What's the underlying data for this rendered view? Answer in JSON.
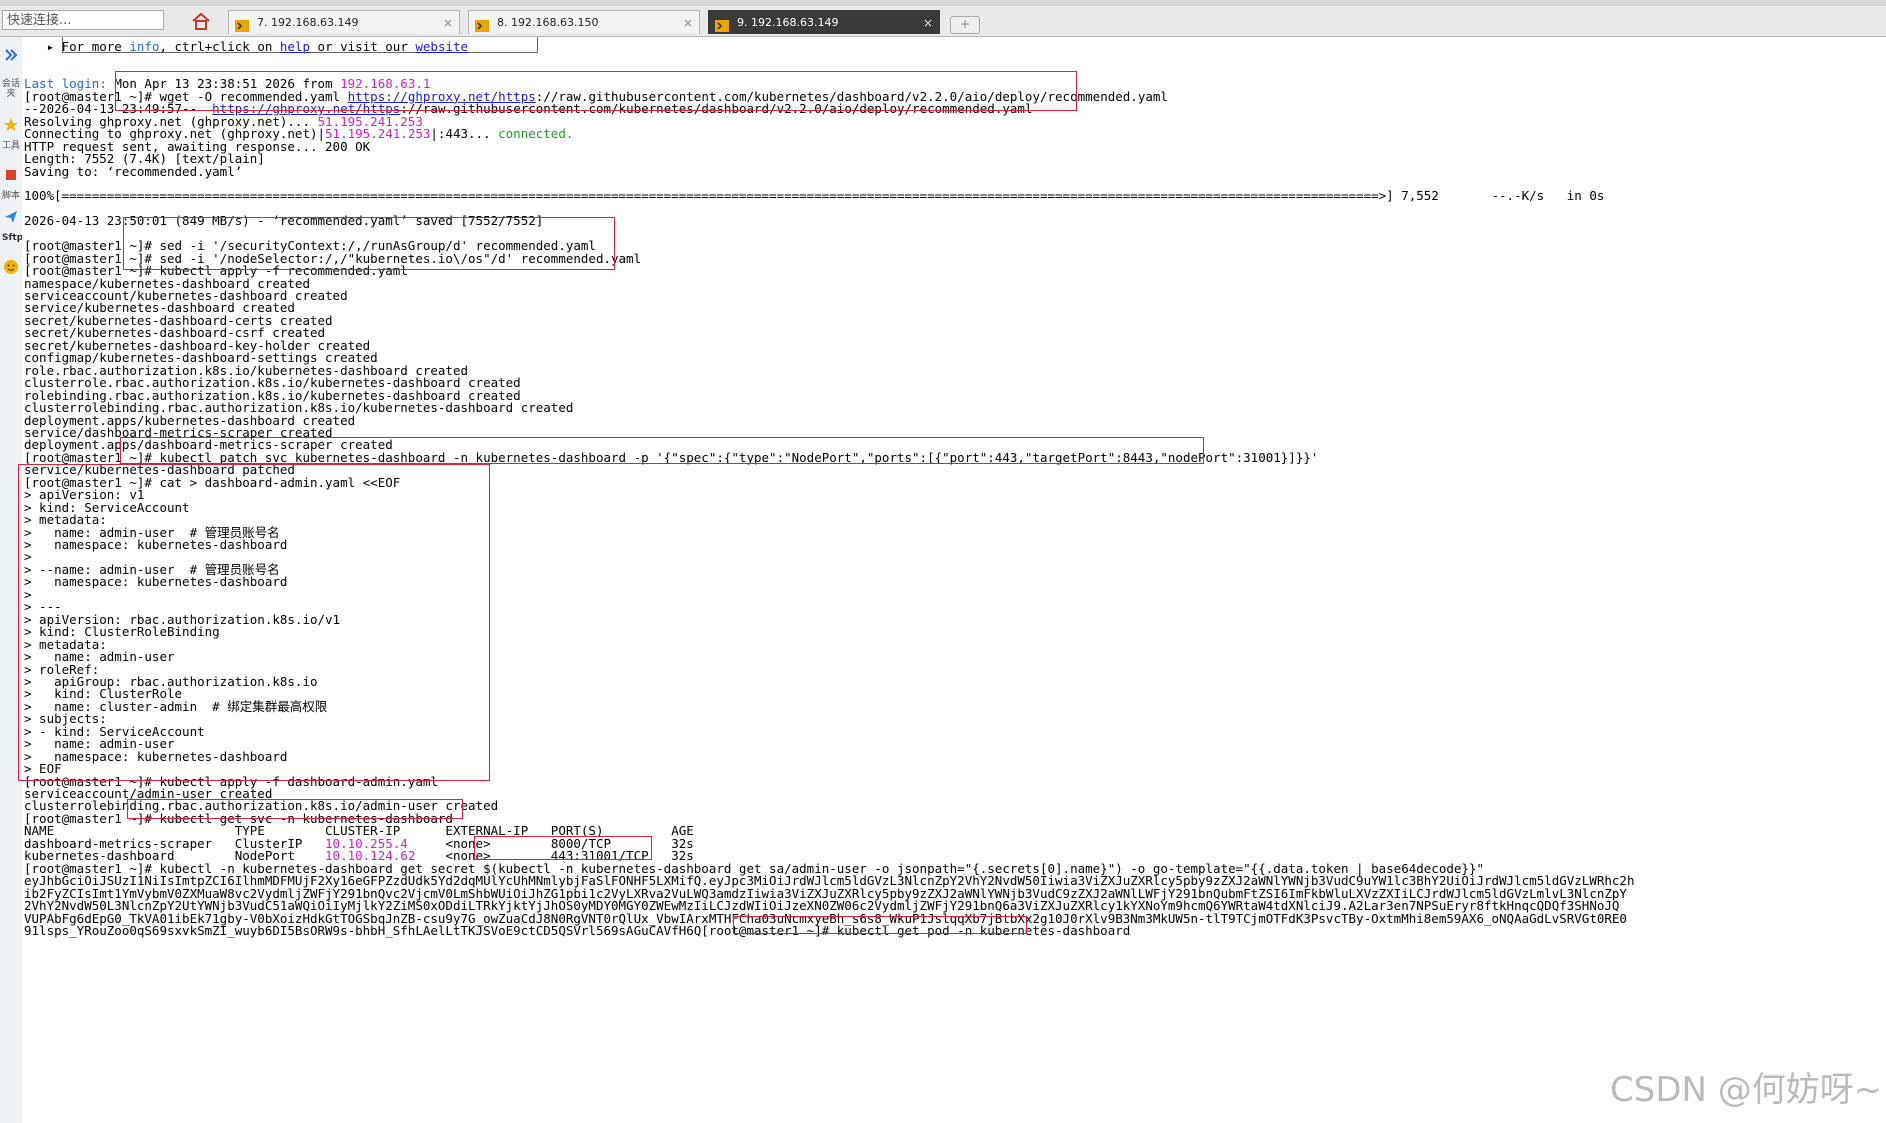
{
  "app": {
    "quick_connect_placeholder": "快速连接...",
    "tabs": [
      {
        "label": "7. 192.168.63.149",
        "active": false
      },
      {
        "label": "8. 192.168.63.150",
        "active": false
      },
      {
        "label": "9. 192.168.63.149",
        "active": true
      }
    ],
    "tab_close": "×",
    "new_tab": "+",
    "sidebar_icons": [
      "expand-icon",
      "favorites-icon",
      "star-icon",
      "tools-icon",
      "plugin-icon",
      "script-icon",
      "send-icon",
      "sftp-icon",
      "smile-icon"
    ],
    "sidebar_labels": {
      "fav": "会话夹",
      "tools": "工具",
      "script": "脚本",
      "sftp": "Sftp"
    }
  },
  "terminal": {
    "lines": [
      {
        "segs": [
          {
            "t": "   "
          },
          {
            "t": "▸ For more "
          },
          {
            "t": "info",
            "c": "c-blue"
          },
          {
            "t": ", ctrl+click on "
          },
          {
            "t": "help",
            "c": "u"
          },
          {
            "t": " or visit our "
          },
          {
            "t": "website",
            "c": "u"
          }
        ]
      },
      {
        "segs": [
          {
            "t": ""
          }
        ]
      },
      {
        "segs": [
          {
            "t": ""
          }
        ]
      },
      {
        "segs": [
          {
            "t": "Last login:",
            "c": "c-blue"
          },
          {
            "t": " Mon Apr 13 23:38:51 2026 from "
          },
          {
            "t": "192.168.63.1",
            "c": "c-mag"
          }
        ]
      },
      {
        "segs": [
          {
            "t": "[root@master1 ~]# wget -O recommended.yaml "
          },
          {
            "t": "https://ghproxy.net/https",
            "c": "u"
          },
          {
            "t": "://raw.githubusercontent.com/kubernetes/dashboard/v2.2.0/aio/deploy/recommended.yaml"
          }
        ]
      },
      {
        "segs": [
          {
            "t": "--2026-04-13 23:49:57--  "
          },
          {
            "t": "https://ghproxy.net/https",
            "c": "u"
          },
          {
            "t": "://raw.githubusercontent.com/kubernetes/dashboard/v2.2.0/aio/deploy/recommended.yaml"
          }
        ]
      },
      {
        "segs": [
          {
            "t": "Resolving ghproxy.net (ghproxy.net)... "
          },
          {
            "t": "51.195.241.253",
            "c": "c-mag"
          }
        ]
      },
      {
        "segs": [
          {
            "t": "Connecting to ghproxy.net (ghproxy.net)|"
          },
          {
            "t": "51.195.241.253",
            "c": "c-mag"
          },
          {
            "t": "|:443... "
          },
          {
            "t": "connected.",
            "c": "c-grn"
          }
        ]
      },
      {
        "segs": [
          {
            "t": "HTTP request sent, awaiting response... 200 OK"
          }
        ]
      },
      {
        "segs": [
          {
            "t": "Length: 7552 (7.4K) [text/plain]"
          }
        ]
      },
      {
        "segs": [
          {
            "t": "Saving to: ‘recommended.yaml’"
          }
        ]
      },
      {
        "segs": [
          {
            "t": ""
          }
        ]
      },
      {
        "segs": [
          {
            "t": "100%[===============================================================================================================================================================================>] 7,552       --.-K/s   in 0s"
          }
        ]
      },
      {
        "segs": [
          {
            "t": ""
          }
        ]
      },
      {
        "segs": [
          {
            "t": "2026-04-13 23:50:01 (849 MB/s) - ‘recommended.yaml’ saved [7552/7552]"
          }
        ]
      },
      {
        "segs": [
          {
            "t": ""
          }
        ]
      },
      {
        "segs": [
          {
            "t": "[root@master1 ~]# sed -i '/securityContext:/,/runAsGroup/d' recommended.yaml"
          }
        ]
      },
      {
        "segs": [
          {
            "t": "[root@master1 ~]# sed -i '/nodeSelector:/,/\"kubernetes.io\\/os\"/d' recommended.yaml"
          }
        ]
      },
      {
        "segs": [
          {
            "t": "[root@master1 ~]# kubectl apply -f recommended.yaml"
          }
        ]
      },
      {
        "segs": [
          {
            "t": "namespace/kubernetes-dashboard created"
          }
        ]
      },
      {
        "segs": [
          {
            "t": "serviceaccount/kubernetes-dashboard created"
          }
        ]
      },
      {
        "segs": [
          {
            "t": "service/kubernetes-dashboard created"
          }
        ]
      },
      {
        "segs": [
          {
            "t": "secret/kubernetes-dashboard-certs created"
          }
        ]
      },
      {
        "segs": [
          {
            "t": "secret/kubernetes-dashboard-csrf created"
          }
        ]
      },
      {
        "segs": [
          {
            "t": "secret/kubernetes-dashboard-key-holder created"
          }
        ]
      },
      {
        "segs": [
          {
            "t": "configmap/kubernetes-dashboard-settings created"
          }
        ]
      },
      {
        "segs": [
          {
            "t": "role.rbac.authorization.k8s.io/kubernetes-dashboard created"
          }
        ]
      },
      {
        "segs": [
          {
            "t": "clusterrole.rbac.authorization.k8s.io/kubernetes-dashboard created"
          }
        ]
      },
      {
        "segs": [
          {
            "t": "rolebinding.rbac.authorization.k8s.io/kubernetes-dashboard created"
          }
        ]
      },
      {
        "segs": [
          {
            "t": "clusterrolebinding.rbac.authorization.k8s.io/kubernetes-dashboard created"
          }
        ]
      },
      {
        "segs": [
          {
            "t": "deployment.apps/kubernetes-dashboard created"
          }
        ]
      },
      {
        "segs": [
          {
            "t": "service/dashboard-metrics-scraper created"
          }
        ]
      },
      {
        "segs": [
          {
            "t": "deployment.apps/dashboard-metrics-scraper created"
          }
        ]
      },
      {
        "segs": [
          {
            "t": "[root@master1 ~]# kubectl patch svc kubernetes-dashboard -n kubernetes-dashboard -p '{\"spec\":{\"type\":\"NodePort\",\"ports\":[{\"port\":443,\"targetPort\":8443,\"nodePort\":31001}]}}'"
          }
        ]
      },
      {
        "segs": [
          {
            "t": "service/kubernetes-dashboard patched"
          }
        ]
      },
      {
        "segs": [
          {
            "t": "[root@master1 ~]# cat > dashboard-admin.yaml <<EOF"
          }
        ]
      },
      {
        "segs": [
          {
            "t": "> apiVersion: v1"
          }
        ]
      },
      {
        "segs": [
          {
            "t": "> kind: ServiceAccount"
          }
        ]
      },
      {
        "segs": [
          {
            "t": "> metadata:"
          }
        ]
      },
      {
        "segs": [
          {
            "t": ">   name: admin-user  # 管理员账号名"
          }
        ]
      },
      {
        "segs": [
          {
            "t": ">   namespace: kubernetes-dashboard"
          }
        ]
      },
      {
        "segs": [
          {
            "t": ">"
          }
        ]
      },
      {
        "segs": [
          {
            "t": "> --name: admin-user  # 管理员账号名"
          }
        ]
      },
      {
        "segs": [
          {
            "t": ">   namespace: kubernetes-dashboard"
          }
        ]
      },
      {
        "segs": [
          {
            "t": ">"
          }
        ]
      },
      {
        "segs": [
          {
            "t": "> ---"
          }
        ]
      },
      {
        "segs": [
          {
            "t": "> apiVersion: rbac.authorization.k8s.io/v1"
          }
        ]
      },
      {
        "segs": [
          {
            "t": "> kind: ClusterRoleBinding"
          }
        ]
      },
      {
        "segs": [
          {
            "t": "> metadata:"
          }
        ]
      },
      {
        "segs": [
          {
            "t": ">   name: admin-user"
          }
        ]
      },
      {
        "segs": [
          {
            "t": "> roleRef:"
          }
        ]
      },
      {
        "segs": [
          {
            "t": ">   apiGroup: rbac.authorization.k8s.io"
          }
        ]
      },
      {
        "segs": [
          {
            "t": ">   kind: ClusterRole"
          }
        ]
      },
      {
        "segs": [
          {
            "t": ">   name: cluster-admin  # 绑定集群最高权限"
          }
        ]
      },
      {
        "segs": [
          {
            "t": "> subjects:"
          }
        ]
      },
      {
        "segs": [
          {
            "t": "> - kind: ServiceAccount"
          }
        ]
      },
      {
        "segs": [
          {
            "t": ">   name: admin-user"
          }
        ]
      },
      {
        "segs": [
          {
            "t": ">   namespace: kubernetes-dashboard"
          }
        ]
      },
      {
        "segs": [
          {
            "t": "> EOF"
          }
        ]
      },
      {
        "segs": [
          {
            "t": "[root@master1 ~]# kubectl apply -f dashboard-admin.yaml"
          }
        ]
      },
      {
        "segs": [
          {
            "t": "serviceaccount/admin-user created"
          }
        ]
      },
      {
        "segs": [
          {
            "t": "clusterrolebinding.rbac.authorization.k8s.io/admin-user created"
          }
        ]
      },
      {
        "segs": [
          {
            "t": "[root@master1 ~]# kubectl get svc -n kubernetes-dashboard"
          }
        ]
      },
      {
        "segs": [
          {
            "t": "NAME                        TYPE        CLUSTER-IP      EXTERNAL-IP   PORT(S)         AGE"
          }
        ]
      },
      {
        "segs": [
          {
            "t": "dashboard-metrics-scraper   ClusterIP   "
          },
          {
            "t": "10.10.255.4",
            "c": "c-mag"
          },
          {
            "t": "     <none>        8000/TCP        32s"
          }
        ]
      },
      {
        "segs": [
          {
            "t": "kubernetes-dashboard        NodePort    "
          },
          {
            "t": "10.10.124.62",
            "c": "c-mag"
          },
          {
            "t": "    <none>        443:31001/TCP   32s"
          }
        ]
      },
      {
        "segs": [
          {
            "t": "[root@master1 ~]# kubectl -n kubernetes-dashboard get secret $(kubectl -n kubernetes-dashboard get sa/admin-user -o jsonpath=\"{.secrets[0].name}\") -o go-template=\"{{.data.token | base64decode}}\""
          }
        ]
      },
      {
        "segs": [
          {
            "t": "eyJhbGciOiJSUzI1NiIsImtpZCI6IlhmMDFMUjF2Xy16eGFPZzdUdk5Yd2dqMUlYcUhMNmlybjFaSlFONHF5LXMifQ.eyJpc3MiOiJrdWJlcm5ldGVzL3NlcnZpY2VhY2NvdW50Iiwia3ViZXJuZXRlcy5pby9zZXJ2aWNlYWNjb3VudC9uYW1lc3BhY2UiOiJrdWJlcm5ldGVzLWRhc2h"
          }
        ]
      },
      {
        "segs": [
          {
            "t": "ib2FyZCIsImt1YmVybmV0ZXMuaW8vc2VydmljZWFjY291bnQvc2VjcmV0LmShbWUiOiJhZG1pbi1c2VyLXRva2VuLWQ3amdzIiwia3ViZXJuZXRlcy5pby9zZXJ2aWNlYWNjb3VudC9zZXJ2aWNlLWFjY291bnQubmFtZSI6ImFkbWluLXVzZXIiLCJrdWJlcm5ldGVzLmlvL3NlcnZpY"
          }
        ]
      },
      {
        "segs": [
          {
            "t": "2VhY2NvdW50L3NlcnZpY2UtYWNjb3VudC51aWQiOiIyMjlkY2ZiMS0xODdiLTRkYjktYjJhOS0yMDY0MGY0ZWEwMzIiLCJzdWIiOiJzeXN0ZW06c2VydmljZWFjY291bnQ6a3ViZXJuZXRlcy1kYXNoYm9hcmQ6YWRtaW4tdXNlciJ9.A2Lar3en7NPSuEryr8ftkHnqcQDQf3SHNoJQ"
          }
        ]
      },
      {
        "segs": [
          {
            "t": "VUPAbFg6dEpG0_TkVA01ibEk71gby-V0bXoizHdkGtTOGSbqJnZB-csu9y7G_owZuaCdJ8N0RgVNT0rQlUx_VbwIArxMTHFCha03uNcmxyeBh_s6s8_WkuP1JslqqXb7jBtbXx2g10J0rXlv9B3Nm3MkUW5n-tlT9TCjmOTFdK3PsvcTBy-OxtmMhi8em59AX6_oNQAaGdLvSRVGt0RE0"
          }
        ]
      },
      {
        "segs": [
          {
            "t": "91lsps_YRouZoo0qS69sxvkSmZI_wuyb6DI5BsORW9s-bhbH_SfhLAelLtTKJSVoE9ctCD5QSVrl569sAGuCAVfH6Q[root@master1 ~]# kubectl get pod -n kubernetes-dashboard"
          }
        ]
      }
    ]
  },
  "watermark": "CSDN @何妨呀~"
}
